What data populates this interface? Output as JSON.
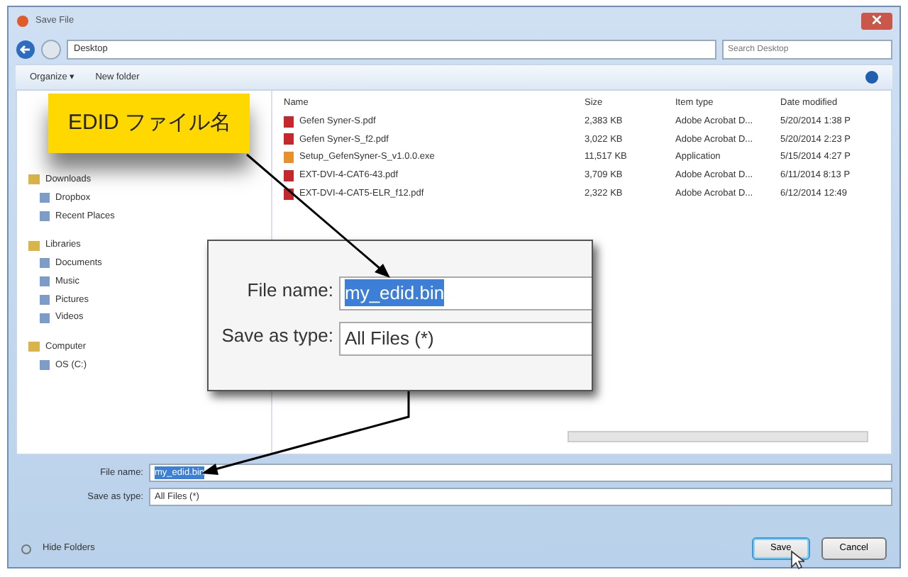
{
  "window": {
    "title": "Save File"
  },
  "address_bar": {
    "location": "Desktop",
    "search_placeholder": "Search Desktop"
  },
  "toolbar": {
    "buttons": [
      "Organize ▾",
      "New folder"
    ]
  },
  "sidebar": {
    "groups": [
      {
        "label": "Downloads",
        "children": [
          {
            "label": "Dropbox"
          },
          {
            "label": "Recent Places"
          }
        ]
      },
      {
        "label": "Libraries",
        "children": [
          {
            "label": "Documents"
          },
          {
            "label": "Music"
          },
          {
            "label": "Pictures"
          },
          {
            "label": "Videos"
          }
        ]
      },
      {
        "label": "Computer",
        "children": [
          {
            "label": "OS (C:)"
          }
        ]
      }
    ]
  },
  "table": {
    "columns": [
      "Name",
      "Size",
      "Item type",
      "Date modified"
    ],
    "rows": [
      {
        "kind": "pdf",
        "cells": [
          "Gefen Syner-S.pdf",
          "2,383 KB",
          "Adobe Acrobat D...",
          "5/20/2014 1:38 P"
        ]
      },
      {
        "kind": "pdf",
        "cells": [
          "Gefen Syner-S_f2.pdf",
          "3,022 KB",
          "Adobe Acrobat D...",
          "5/20/2014 2:23 P"
        ]
      },
      {
        "kind": "exe",
        "cells": [
          "Setup_GefenSyner-S_v1.0.0.exe",
          "11,517 KB",
          "Application",
          "5/15/2014 4:27 P"
        ]
      },
      {
        "kind": "pdf",
        "cells": [
          "EXT-DVI-4-CAT6-43.pdf",
          "3,709 KB",
          "Adobe Acrobat D...",
          "6/11/2014 8:13 P"
        ]
      },
      {
        "kind": "pdf",
        "cells": [
          "EXT-DVI-4-CAT5-ELR_f12.pdf",
          "2,322 KB",
          "Adobe Acrobat D...",
          "6/12/2014 12:49"
        ]
      }
    ]
  },
  "form": {
    "file_name_label": "File name:",
    "file_name": "my_edid.bin",
    "file_name_selected": true,
    "type_label": "Save as type:",
    "type": "All Files (*)"
  },
  "footer": {
    "hide_folders": "Hide Folders",
    "buttons": [
      {
        "label": "Save",
        "selected": true
      },
      {
        "label": "Cancel",
        "selected": false
      }
    ]
  },
  "callout": {
    "label": "EDID ファイル名",
    "zoom": {
      "file_name_label": "File name:",
      "file_name": "my_edid.bin",
      "file_name_selected": true,
      "type_label": "Save as type:",
      "type": "All Files (*)"
    }
  }
}
